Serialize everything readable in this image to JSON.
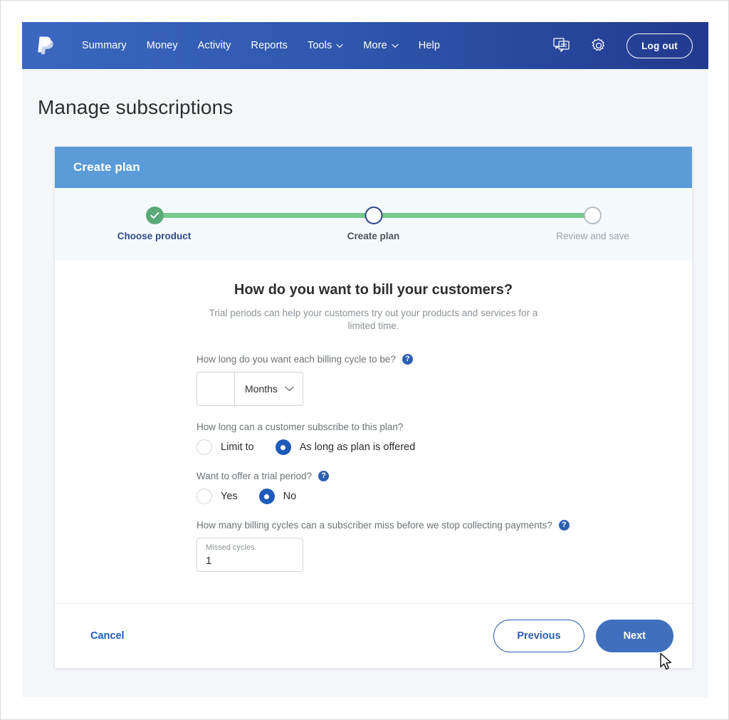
{
  "nav": {
    "logo_icon": "paypal-logo-icon",
    "links": [
      {
        "label": "Summary",
        "caret": ""
      },
      {
        "label": "Money",
        "caret": ""
      },
      {
        "label": "Activity",
        "caret": ""
      },
      {
        "label": "Reports",
        "caret": ""
      },
      {
        "label": "Tools",
        "caret": "⌄"
      },
      {
        "label": "More",
        "caret": "⌄"
      },
      {
        "label": "Help",
        "caret": ""
      }
    ],
    "chat_icon": "chat-bubble-icon",
    "settings_icon": "gear-icon",
    "logout_label": "Log out",
    "bg_from": "#3b67bf",
    "bg_to": "#223a8f"
  },
  "page": {
    "title": "Manage subscriptions"
  },
  "card": {
    "header_title": "Create plan",
    "header_bg": "#5a9bd8"
  },
  "stepper": {
    "steps": [
      {
        "label": "Choose product",
        "state": "done"
      },
      {
        "label": "Create plan",
        "state": "current"
      },
      {
        "label": "Review and save",
        "state": "future"
      }
    ],
    "done_color": "#5aaa78",
    "fill_color": "#78c98e",
    "track_color": "#c9cdd2",
    "check_glyph": "✓"
  },
  "form": {
    "heading": "How do you want to bill your customers?",
    "subtitle": "Trial periods can help your customers try out your products and services for a limited time.",
    "billing_cycle": {
      "question": "How long do you want each billing cycle to be?",
      "help_glyph": "?",
      "number_value": "",
      "number_placeholder": "",
      "unit_value": "Months",
      "chevron": "⌄"
    },
    "subscribe_length": {
      "question": "How long can a customer subscribe to this plan?",
      "options": [
        {
          "label": "Limit to",
          "selected": false
        },
        {
          "label": "As long as plan is offered",
          "selected": true
        }
      ]
    },
    "trial_period": {
      "question": "Want to offer a trial period?",
      "help_glyph": "?",
      "options": [
        {
          "label": "Yes",
          "selected": false
        },
        {
          "label": "No",
          "selected": true
        }
      ]
    },
    "missed_cycles": {
      "question": "How many billing cycles can a subscriber miss before we stop collecting payments?",
      "help_glyph": "?",
      "field_caption": "Missed cycles",
      "field_value": "1"
    }
  },
  "footer": {
    "cancel_label": "Cancel",
    "previous_label": "Previous",
    "next_label": "Next",
    "primary_color": "#4070bd"
  }
}
